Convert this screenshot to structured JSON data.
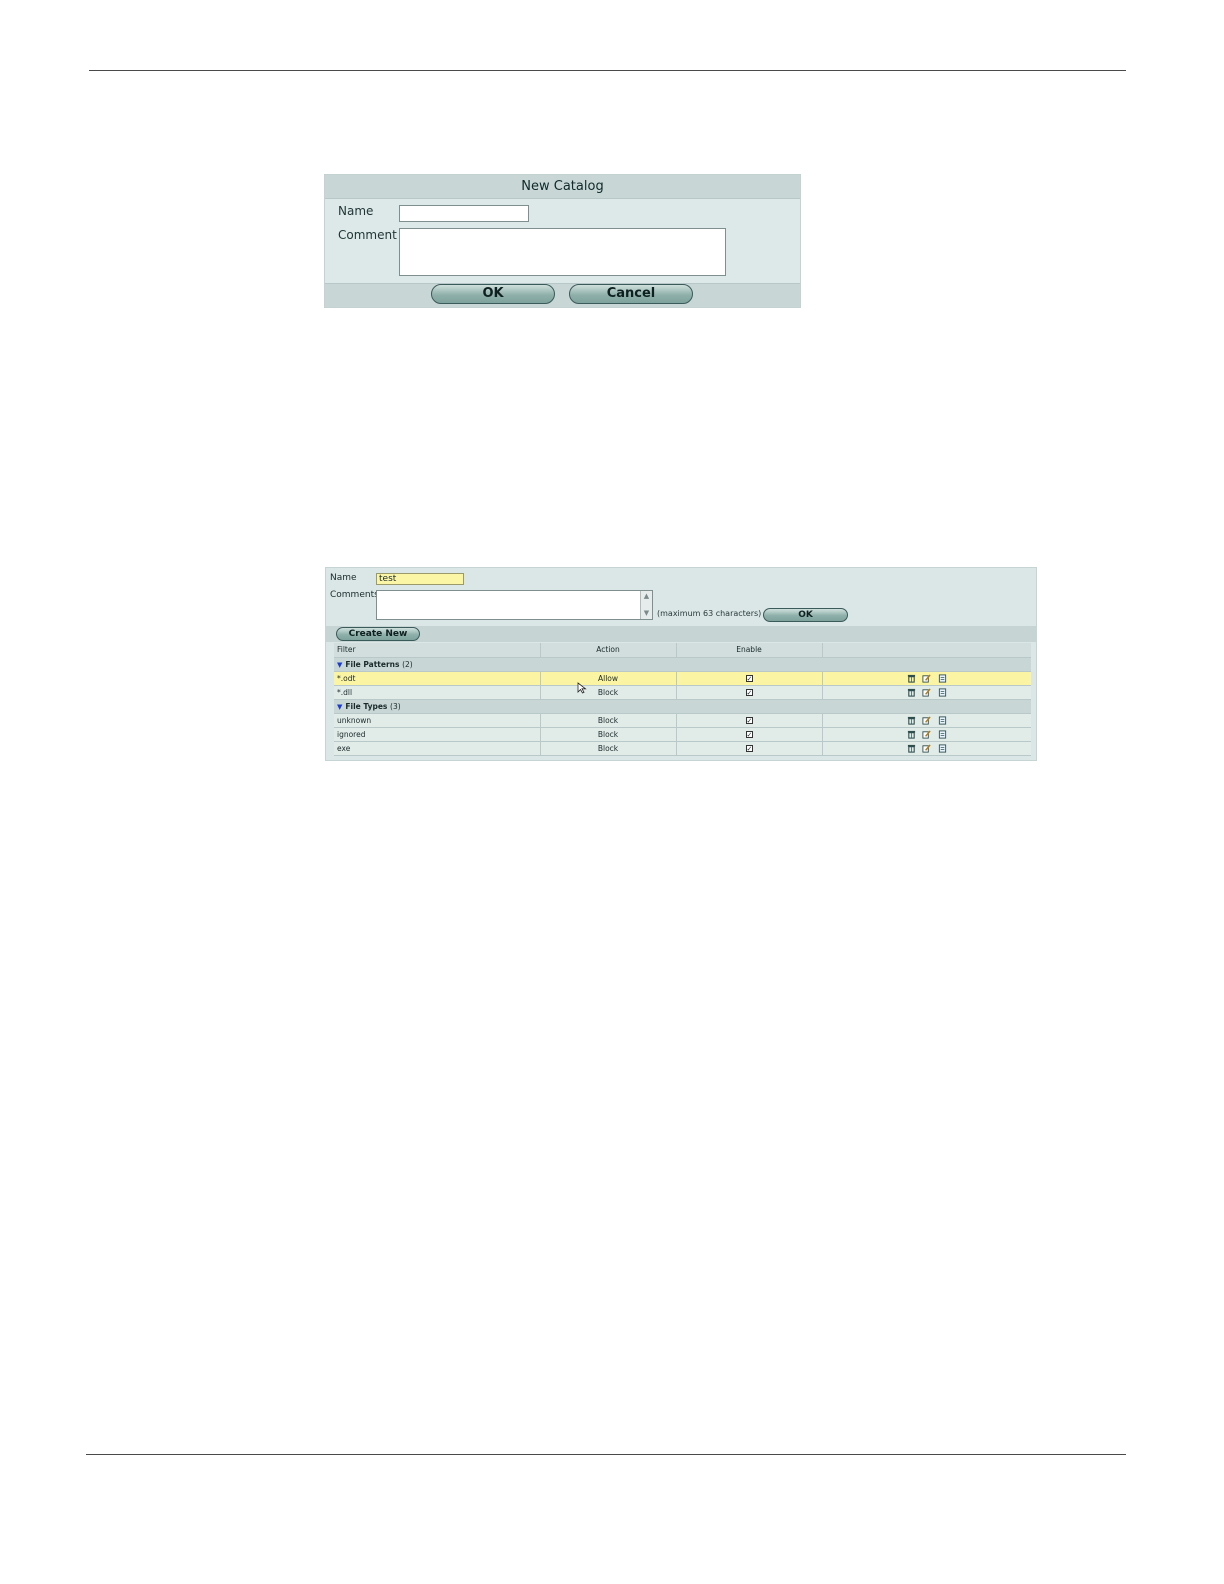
{
  "dialog_new_catalog": {
    "title": "New Catalog",
    "name_label": "Name",
    "name_value": "",
    "comment_label": "Comment",
    "comment_value": "",
    "ok_label": "OK",
    "cancel_label": "Cancel"
  },
  "file_filter": {
    "name_label": "Name",
    "name_value": "test",
    "comments_label": "Comments",
    "comments_value": "",
    "max_chars_text": "(maximum 63 characters)",
    "ok_label": "OK",
    "create_new_label": "Create New",
    "columns": {
      "filter": "Filter",
      "action": "Action",
      "enable": "Enable"
    },
    "groups": [
      {
        "name": "File Patterns",
        "count": "(2)",
        "rows": [
          {
            "filter": "*.odt",
            "action": "Allow",
            "enabled": true,
            "highlighted": true
          },
          {
            "filter": "*.dll",
            "action": "Block",
            "enabled": true,
            "highlighted": false
          }
        ]
      },
      {
        "name": "File Types",
        "count": "(3)",
        "rows": [
          {
            "filter": "unknown",
            "action": "Block",
            "enabled": true,
            "highlighted": false
          },
          {
            "filter": "ignored",
            "action": "Block",
            "enabled": true,
            "highlighted": false
          },
          {
            "filter": "exe",
            "action": "Block",
            "enabled": true,
            "highlighted": false
          }
        ]
      }
    ],
    "row_icons": [
      "delete-icon",
      "edit-icon",
      "insert-icon"
    ]
  },
  "colors": {
    "panel_bg": "#dbe7e7",
    "header_bg": "#c9d6d6",
    "highlight_row": "#fbf4a3",
    "button_fill": "#8fb0aa"
  }
}
